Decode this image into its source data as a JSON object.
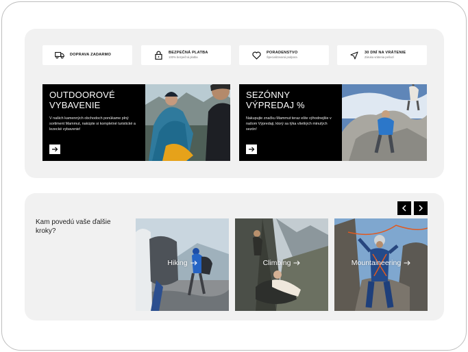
{
  "features": [
    {
      "title": "DOPRAVA ZADARMO",
      "subtitle": "",
      "icon": "truck-icon"
    },
    {
      "title": "BEZPEČNÁ PLATBA",
      "subtitle": "100% bezpečná platba",
      "icon": "lock-icon"
    },
    {
      "title": "PORADENSTVO",
      "subtitle": "Špecializovaná podpora",
      "icon": "heart-icon"
    },
    {
      "title": "30 DNÍ NA VRÁTENIE",
      "subtitle": "Záruka vrátenia peňazí",
      "icon": "navigation-arrow-icon"
    }
  ],
  "promos": [
    {
      "heading_line1": "OUTDOOROVÉ",
      "heading_line2": "VYBAVENIE",
      "description": "V našich kamenných obchodoch ponúkame plný sortiment Mammut, nakúpte si kompletné turistické a lezecké vybavenie!"
    },
    {
      "heading_line1": "SEZÓNNY",
      "heading_line2": "VÝPREDAJ %",
      "description": "Nakupujte značku Mammut teraz ešte výhodnejšie v našom Výpredaji, ktorý sa týka všetkých minulých sezón!"
    }
  ],
  "next_steps": {
    "title": "Kam povedú vaše ďalšie kroky?",
    "tiles": [
      {
        "label": "Hiking"
      },
      {
        "label": "Climbing"
      },
      {
        "label": "Mountaineering"
      }
    ]
  },
  "colors": {
    "accent": "#000000",
    "panel": "#f1f1f1"
  }
}
